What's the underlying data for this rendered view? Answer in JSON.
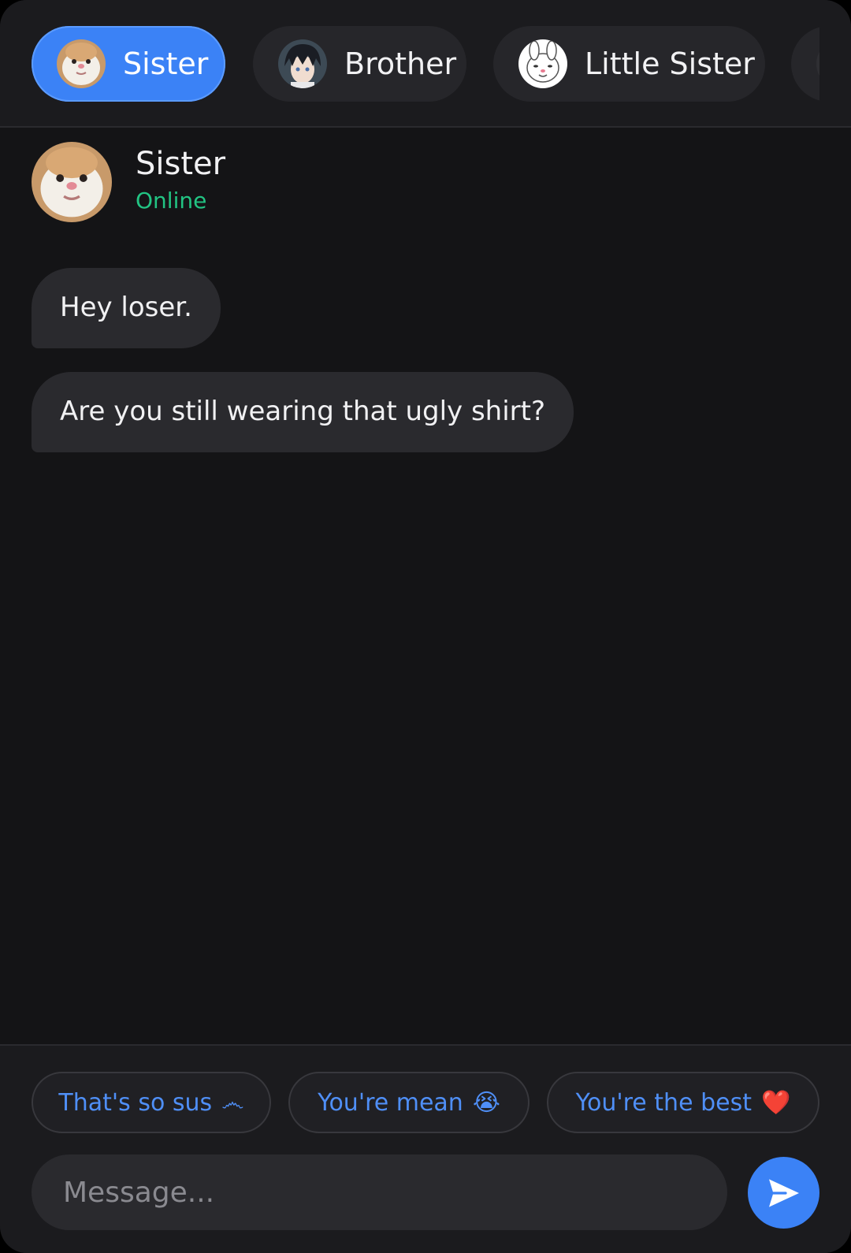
{
  "colors": {
    "background": "#141416",
    "surface": "#1b1b1e",
    "bubble": "#2a2a2e",
    "accent": "#3b82f6",
    "online": "#22c483",
    "chip_text": "#4f8ff7"
  },
  "tabs": [
    {
      "label": "Sister",
      "active": true,
      "avatar": "cat-avatar"
    },
    {
      "label": "Brother",
      "active": false,
      "avatar": "anime-boy-avatar"
    },
    {
      "label": "Little Sister",
      "active": false,
      "avatar": "bunny-avatar"
    },
    {
      "label": "",
      "active": false,
      "avatar": "partial-avatar"
    }
  ],
  "chat": {
    "name": "Sister",
    "status": "Online",
    "avatar": "cat-avatar"
  },
  "messages": [
    {
      "text": "Hey loser."
    },
    {
      "text": "Are you still wearing that ugly shirt?"
    }
  ],
  "quick_replies": [
    {
      "label": "That's so sus",
      "emoji": "෴"
    },
    {
      "label": "You're mean",
      "emoji": "😭"
    },
    {
      "label": "You're the best",
      "emoji": "❤️"
    }
  ],
  "composer": {
    "placeholder": "Message...",
    "value": "",
    "send_icon": "send-icon"
  }
}
